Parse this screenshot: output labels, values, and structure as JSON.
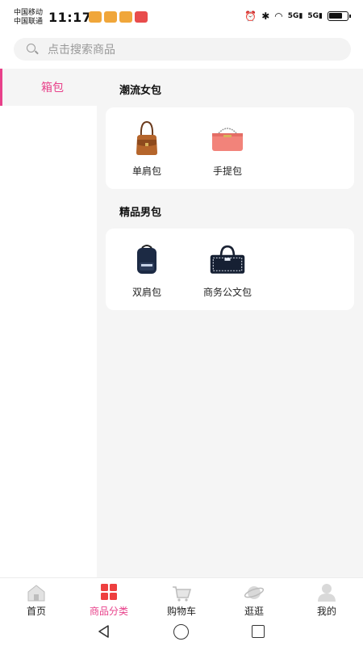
{
  "status_bar": {
    "carrier1": "中国移动",
    "carrier2": "中国联通",
    "time": "11:17",
    "network1": "5G",
    "network2": "5G"
  },
  "search": {
    "placeholder": "点击搜索商品",
    "icon": "search-icon"
  },
  "sidebar": {
    "items": [
      {
        "label": "箱包",
        "active": true
      }
    ]
  },
  "sections": [
    {
      "title": "潮流女包",
      "products": [
        {
          "name": "单肩包",
          "icon": "shoulder-bag-icon"
        },
        {
          "name": "手提包",
          "icon": "handbag-icon"
        }
      ]
    },
    {
      "title": "精品男包",
      "products": [
        {
          "name": "双肩包",
          "icon": "backpack-icon"
        },
        {
          "name": "商务公文包",
          "icon": "briefcase-icon"
        }
      ]
    }
  ],
  "tabbar": {
    "items": [
      {
        "label": "首页",
        "icon": "home-icon",
        "active": false
      },
      {
        "label": "商品分类",
        "icon": "category-icon",
        "active": true
      },
      {
        "label": "购物车",
        "icon": "cart-icon",
        "active": false
      },
      {
        "label": "逛逛",
        "icon": "planet-icon",
        "active": false
      },
      {
        "label": "我的",
        "icon": "user-icon",
        "active": false
      }
    ]
  },
  "colors": {
    "accent": "#e8418a",
    "background": "#f5f5f5",
    "card": "#ffffff"
  }
}
